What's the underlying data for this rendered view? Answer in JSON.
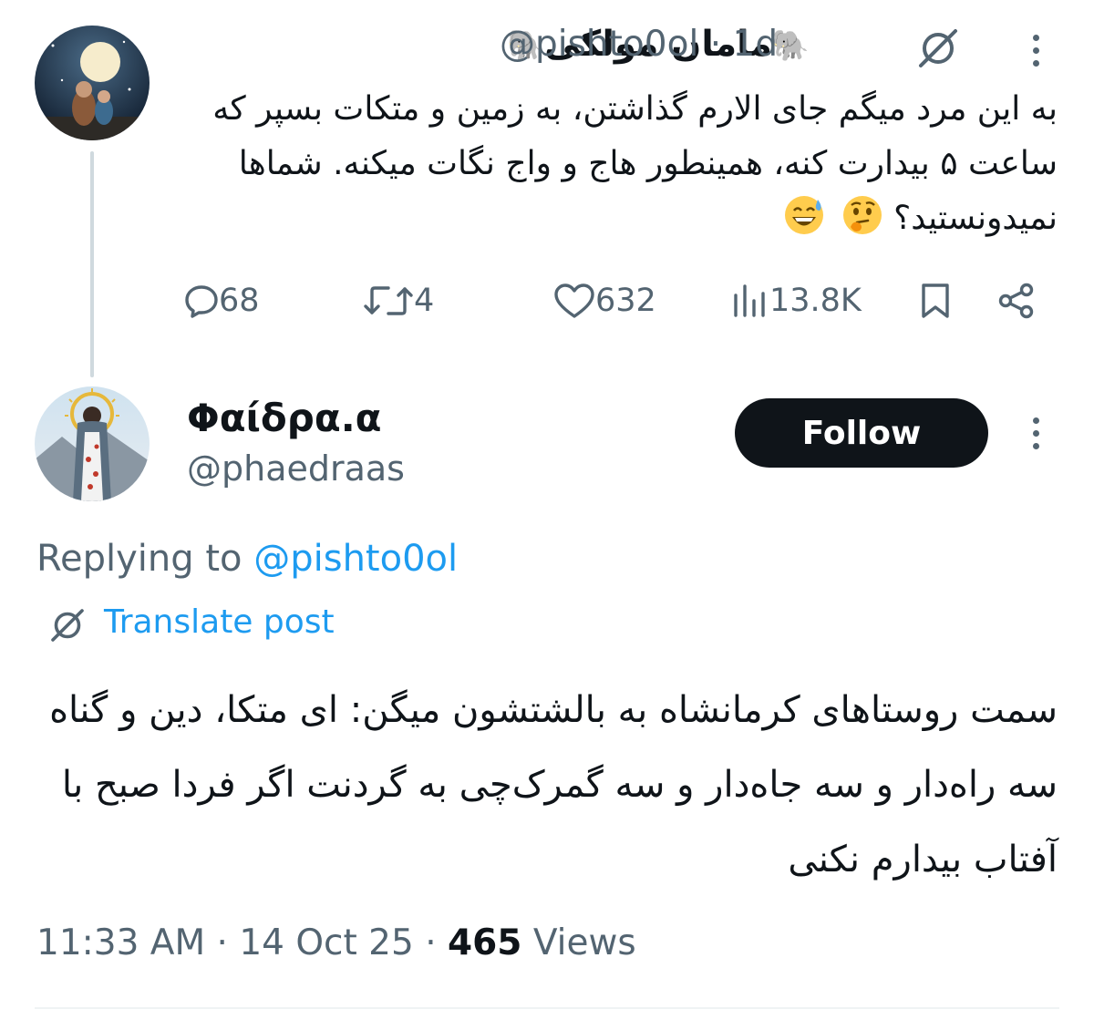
{
  "parent_tweet": {
    "display_name": "ماما‌ن مولکی",
    "name_emoji": "🐘",
    "handle": "@pishto0ol",
    "time_ago": "1d",
    "text": "به این مرد میگم جای الارم گذاشتن، به زمین و متکات بسپر که ساعت ۵ بیدارت کنه، همینطور هاج و واج نگات میکنه. شماها نمیدونستید؟",
    "text_emojis": [
      "thinking-face",
      "grinning-sweat-face"
    ],
    "stats": {
      "replies": "68",
      "reposts": "4",
      "likes": "632",
      "views": "13.8K"
    }
  },
  "reply": {
    "display_name": "Φαίδρα.α",
    "handle": "@phaedraas",
    "follow_label": "Follow",
    "replying_to_label": "Replying to",
    "replying_to_handle": "@pishto0ol",
    "translate_label": "Translate post",
    "text": "سمت روستاهای کرمانشاه به بالشتشون میگن: ای متکا، دین و گناه سه راه‌دار و سه جاه‌دار و سه گمرک‌چی به گردنت اگر فردا صبح با آفتاب بیدارم نکنی",
    "time": "11:33 AM",
    "date": "14 Oct 25",
    "views_count": "465",
    "views_label": "Views"
  },
  "colors": {
    "text_primary": "#0f1419",
    "text_secondary": "#536471",
    "link": "#1d9bf0",
    "follow_bg": "#0f1419",
    "thread_line": "#cfd9de"
  }
}
